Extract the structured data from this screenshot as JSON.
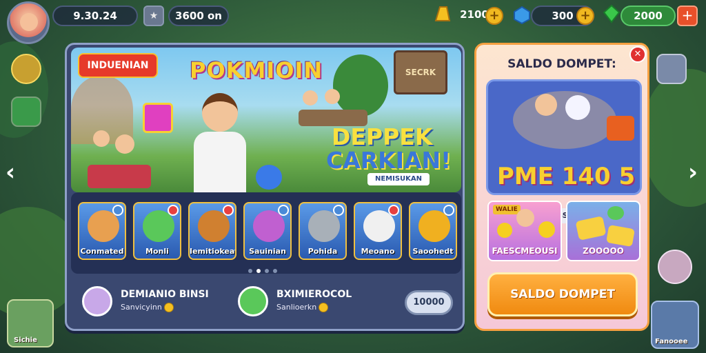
{
  "colors": {
    "accent": "#f08a10",
    "panel": "#3a4870",
    "gold": "#f8d030",
    "tag_red": "#e63a2a"
  },
  "topbar": {
    "level": "9.30.24",
    "resource_left": "3600 on",
    "star_icon": "star-icon",
    "gold_amount": "2100",
    "gem_amount": "300",
    "cash_amount": "2000"
  },
  "banner": {
    "tag": "INDUENIAN",
    "game_title": "POKMIOIN",
    "sign_text": "SECRK",
    "promo_line1": "DEPPEK",
    "promo_line2": "CARKIAN!",
    "promo_sub": "NEMISUKAN"
  },
  "characters": [
    {
      "label": "Conmated",
      "color": "#e8a050",
      "badge": "#4a8ad8"
    },
    {
      "label": "Monli",
      "color": "#5ac85a",
      "badge": "#e84040"
    },
    {
      "label": "Iemitiokeat",
      "color": "#d08030",
      "badge": "#e84040"
    },
    {
      "label": "Sauinian",
      "color": "#c060d0",
      "badge": "#4a8ad8"
    },
    {
      "label": "Pohida",
      "color": "#a8b0b8",
      "badge": "#4a8ad8"
    },
    {
      "label": "Meoano",
      "color": "#f0f0f0",
      "badge": "#e84040"
    },
    {
      "label": "Saoohedt",
      "color": "#f0b020",
      "badge": "#4a8ad8"
    }
  ],
  "rewards": [
    {
      "title": "DEMIANIO BINSI",
      "subtitle": "Sanvicyinn"
    },
    {
      "title": "BXIMIEROCOL",
      "subtitle": "Sanlioerkn"
    }
  ],
  "value_button": "10000",
  "wallet": {
    "title": "SALDO DOMPET:",
    "amount": "PME 140 5",
    "subtitle": "S30SSSSMOOUE",
    "mini1_top": "WALIE",
    "mini1_label": "FAESCMEOUSI",
    "mini2_label": "ZOOOOO",
    "button_label": "SALDO DOMPET"
  },
  "corners": {
    "left": "Sichie",
    "right": "Fanooee"
  }
}
